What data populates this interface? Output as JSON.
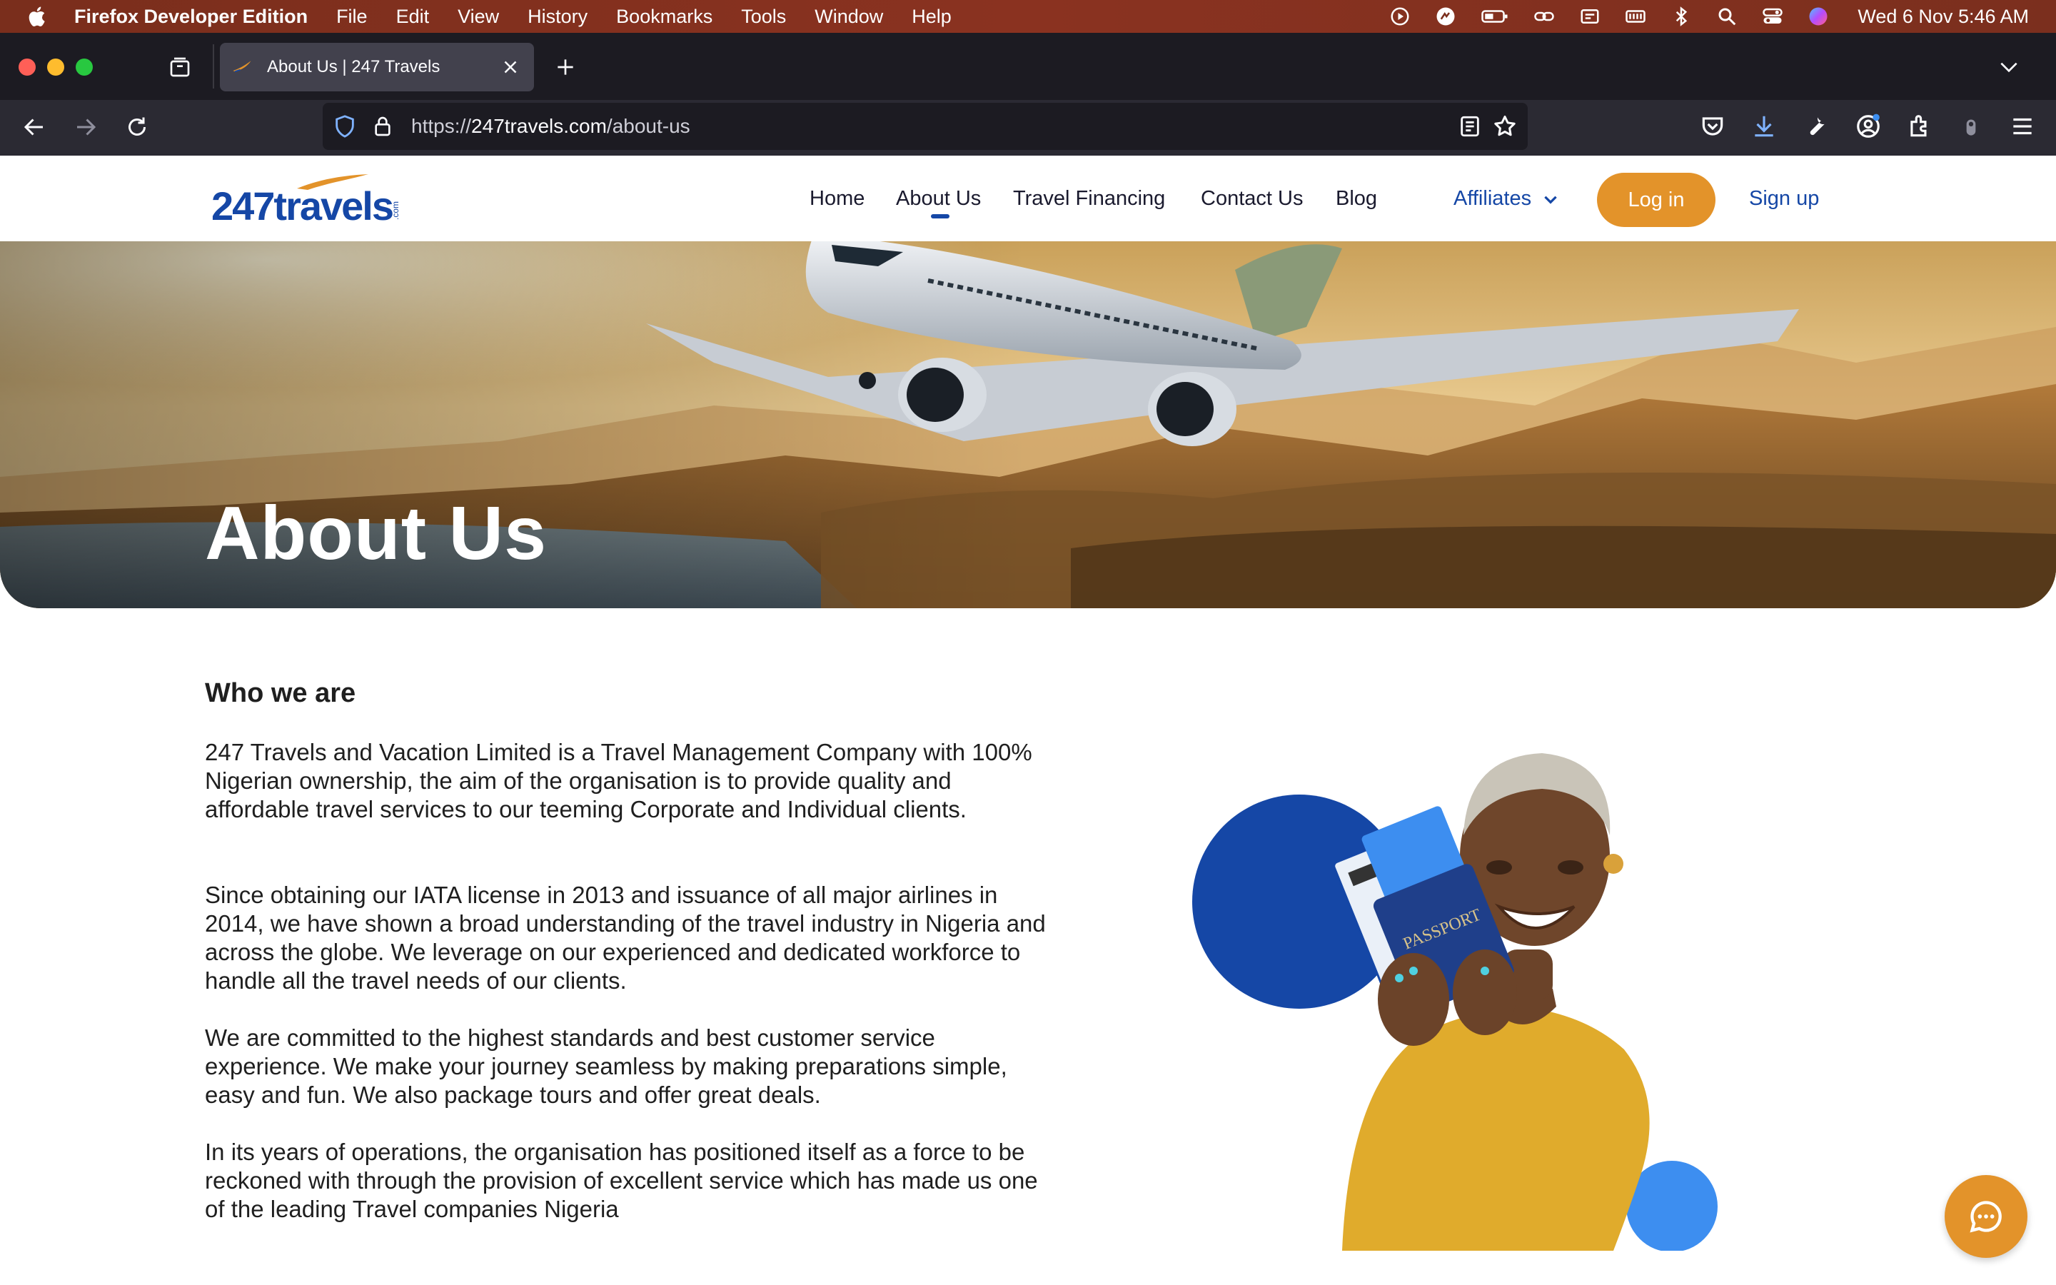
{
  "menubar": {
    "app_name": "Firefox Developer Edition",
    "items": [
      "File",
      "Edit",
      "View",
      "History",
      "Bookmarks",
      "Tools",
      "Window",
      "Help"
    ],
    "clock": "Wed 6 Nov  5:46 AM"
  },
  "browser": {
    "tab_title": "About Us | 247 Travels",
    "url_prefix": "https://",
    "url_host": "247travels.com",
    "url_path": "/about-us"
  },
  "site": {
    "logo_text": "247travels",
    "logo_suffix": ".com",
    "nav": {
      "home": "Home",
      "about": "About Us",
      "financing": "Travel Financing",
      "contact": "Contact Us",
      "blog": "Blog",
      "affiliates": "Affiliates",
      "login": "Log in",
      "signup": "Sign up"
    },
    "hero_title": "About Us",
    "section_title": "Who we are",
    "paragraphs": [
      "247 Travels and Vacation Limited is a Travel Management Company with 100% Nigerian ownership, the aim of the organisation is to provide quality and affordable travel services to our teeming Corporate and Individual clients.",
      "Since obtaining our IATA license in 2013 and issuance of all major airlines in 2014, we have shown a broad understanding of the travel industry in Nigeria and across the globe. We leverage on our experienced and dedicated workforce to handle all the travel needs of our clients.",
      "We are committed to the highest standards and best customer service experience. We make your journey seamless by making preparations simple, easy and fun. We also package tours and offer great deals.",
      "In its years of operations, the organisation has positioned itself as a force to be reckoned with through the provision of excellent service which has made us one of the leading Travel companies Nigeria"
    ],
    "passport_text": "PASSPORT"
  },
  "colors": {
    "brand_blue": "#1547a6",
    "brand_orange": "#e3932a",
    "light_blue": "#3d8ef0",
    "sweater": "#e0ab2c"
  },
  "icons": [
    "apple-icon",
    "screen-record-icon",
    "battery-icon",
    "wifi-icon",
    "bluetooth-icon",
    "search-icon",
    "control-center-icon",
    "siri-icon",
    "tab-overview-icon",
    "close-icon",
    "plus-icon",
    "chevron-down-icon",
    "back-arrow-icon",
    "forward-arrow-icon",
    "reload-icon",
    "shield-icon",
    "lock-icon",
    "reader-view-icon",
    "star-icon",
    "pocket-icon",
    "download-icon",
    "wrench-icon",
    "account-icon",
    "extensions-icon",
    "menu-icon",
    "chat-icon"
  ]
}
